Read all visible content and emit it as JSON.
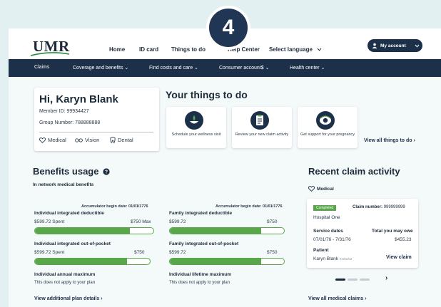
{
  "header": {
    "logo": "UMR",
    "links": [
      "Home",
      "ID card",
      "Things to do",
      "Help Center",
      "Select language"
    ],
    "my_account": "My account",
    "step_badge": "4"
  },
  "nav": {
    "items": [
      "Claims",
      "Coverage and benefits",
      "Find costs and care",
      "Consumer account$",
      "Health center"
    ]
  },
  "member": {
    "greeting": "Hi, Karyn Blank",
    "member_id": "Member ID: 99934427",
    "group_number": "Group Number: 788888888",
    "coverage": [
      "Medical",
      "Vision",
      "Dental"
    ]
  },
  "things_to_do": {
    "title": "Your things to do",
    "cards": [
      "Schedule your wellness visit",
      "Review your new claim activity",
      "Get support for your pregnancy"
    ],
    "view_all": "View all things to do"
  },
  "benefits": {
    "title": "Benefits usage",
    "subtitle": "In network medical benefits",
    "accum_left": "Accumulator begin date: 01/01/1776",
    "accum_right": "Accumulator begin date: 01/01/1776",
    "items": [
      {
        "label": "Individual integrated deductible",
        "spent": "$599.72 Spent",
        "max": "$750 Max",
        "progress": 0.8
      },
      {
        "label": "Family integrated deductible",
        "spent": "$599.72",
        "max": "$750",
        "progress": 0.8
      },
      {
        "label": "Individual integrated out-of-pocket",
        "spent": "$599.72 Spent",
        "max": "$750",
        "progress": 0.8
      },
      {
        "label": "Family integrated out-of-pocket",
        "spent": "$599.72",
        "max": "$750",
        "progress": 0.8
      }
    ],
    "annual_max_label": "Individual annual maximum",
    "annual_max_note": "This does not apply to your plan",
    "lifetime_max_label": "Individual lifetime maximum",
    "lifetime_max_note": "This does not apply to your plan",
    "view_details": "View additional plan details"
  },
  "claims": {
    "title": "Recent claim activity",
    "category": "Medical",
    "status": "Completed",
    "claim_number_label": "Claim number:",
    "claim_number": "999999999",
    "provider": "Hospital One",
    "service_dates_label": "Service dates",
    "service_dates": "07/01/76 - 7/31/76",
    "owe_label": "Total you may owe",
    "owe": "$455.23",
    "patient_label": "Patient",
    "patient": "Karyn Blank",
    "patient_dob": "01/01/02",
    "view_claim": "View claim",
    "view_all": "View all medical claims"
  },
  "colors": {
    "navy": "#1d3049",
    "green": "#5aa64b",
    "background": "#e3f0f1"
  }
}
